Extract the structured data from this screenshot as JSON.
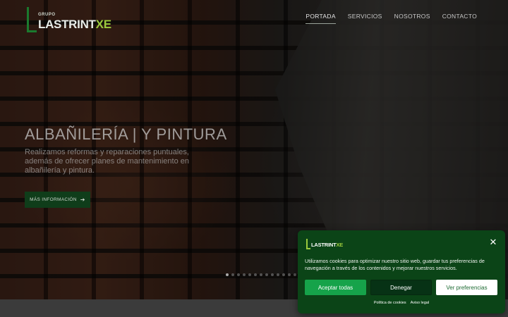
{
  "header": {
    "logo": {
      "small_text": "GRUPO",
      "brand_main": "LASTRINT",
      "brand_accent": "XE"
    },
    "nav": [
      {
        "label": "PORTADA",
        "active": true
      },
      {
        "label": "SERVICIOS",
        "active": false
      },
      {
        "label": "NOSOTROS",
        "active": false
      },
      {
        "label": "CONTACTO",
        "active": false
      }
    ]
  },
  "hero": {
    "title": "ALBAÑILERÍA | Y PINTURA",
    "description": "Realizamos reformas y reparaciones puntuales, además de ofrecer planes de mantenimiento en albañilería y pintura.",
    "button_label": "MÁS INFORMACIÓN",
    "button_icon": "arrow-right-icon",
    "slides_total": 14,
    "slide_active": 1
  },
  "cookie_banner": {
    "logo": {
      "brand_main": "LASTRINT",
      "brand_accent": "XE"
    },
    "close_icon": "close-icon",
    "message": "Utilizamos cookies para optimizar nuestro sitio web, guardar tus preferencias de navegación a través de los contenidos y mejorar nuestros servicios.",
    "accept_label": "Aceptar todas",
    "deny_label": "Denegar",
    "prefs_label": "Ver preferencias",
    "links": [
      "Política de cookies",
      "Aviso legal"
    ]
  },
  "colors": {
    "brand_green": "#0b4417",
    "accent_lime": "#9bc93d",
    "accept_green": "#16a34a"
  }
}
